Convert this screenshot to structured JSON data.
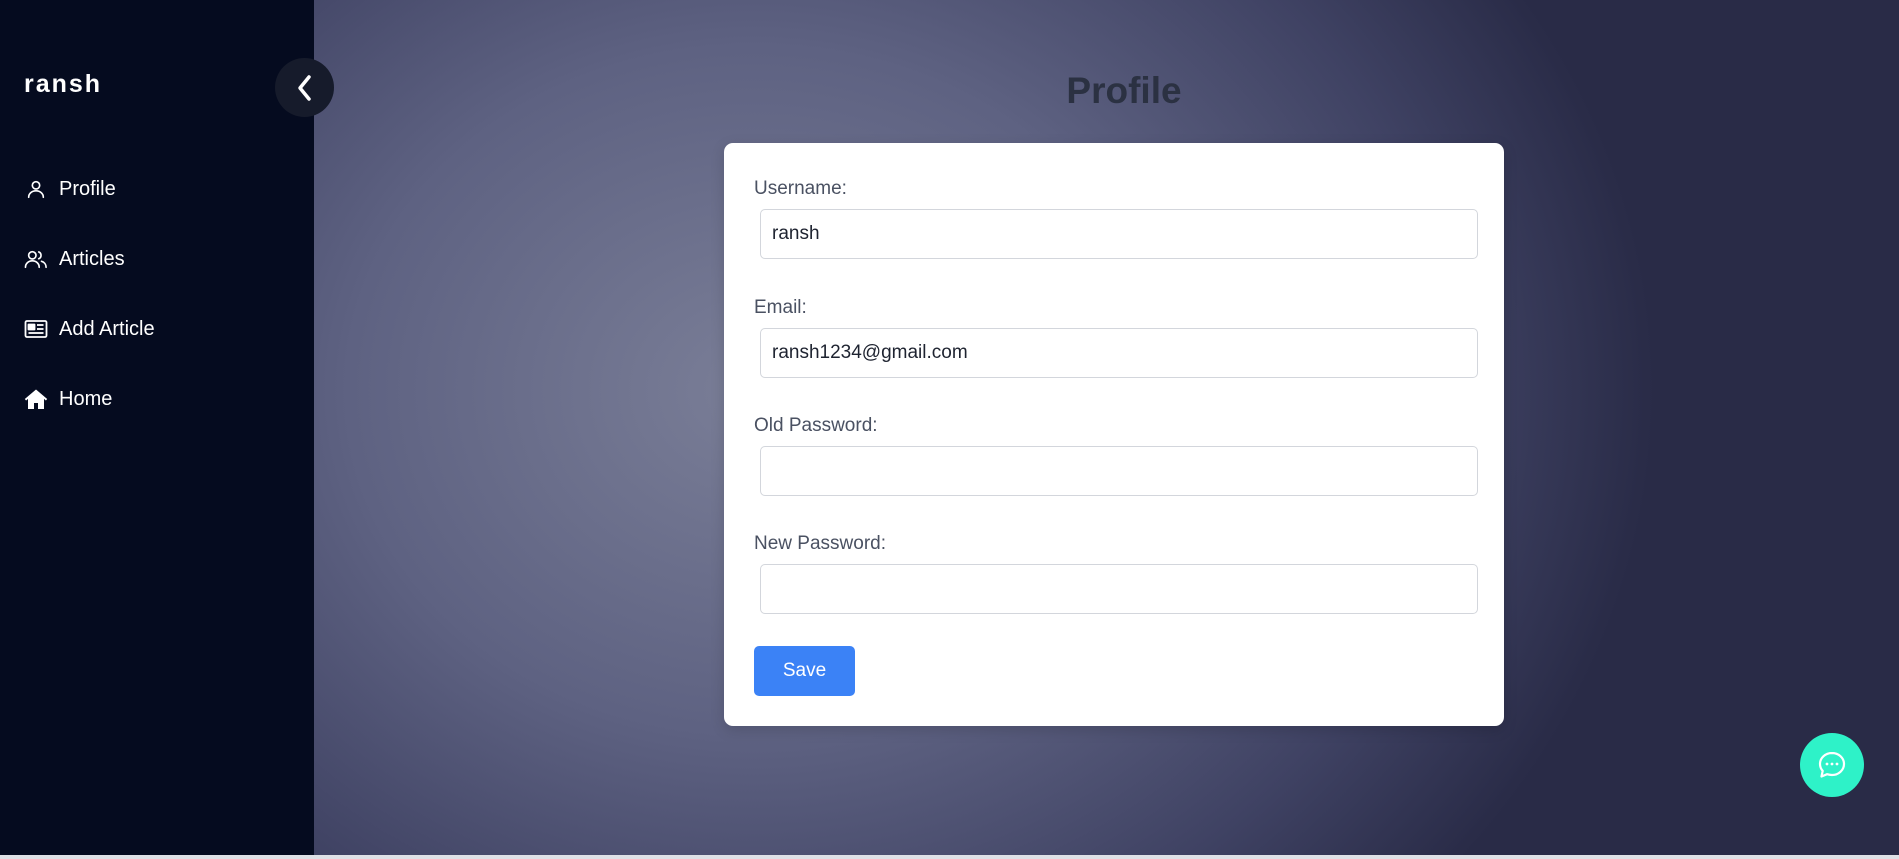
{
  "app": {
    "brand": "ransh"
  },
  "sidebar": {
    "items": [
      {
        "label": "Profile",
        "icon": "user-icon"
      },
      {
        "label": "Articles",
        "icon": "users-icon"
      },
      {
        "label": "Add Article",
        "icon": "newspaper-icon"
      },
      {
        "label": "Home",
        "icon": "home-icon"
      }
    ]
  },
  "main": {
    "title": "Profile"
  },
  "form": {
    "username_label": "Username:",
    "username_value": "ransh",
    "email_label": "Email:",
    "email_value": "ransh1234@gmail.com",
    "old_password_label": "Old Password:",
    "old_password_value": "",
    "new_password_label": "New Password:",
    "new_password_value": "",
    "save_label": "Save"
  },
  "colors": {
    "sidebar_bg": "#050b1f",
    "accent": "#3b82f6",
    "chat_fab": "#2ef2c8"
  }
}
